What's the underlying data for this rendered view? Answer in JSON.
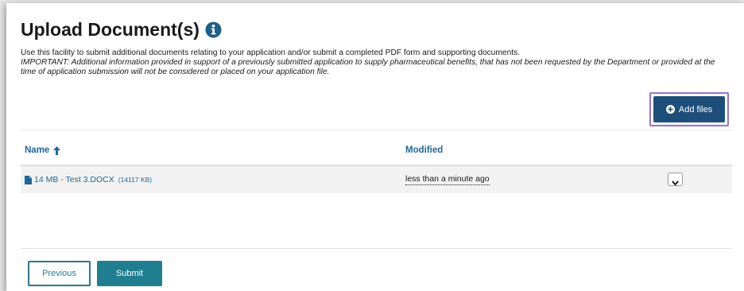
{
  "page": {
    "title": "Upload Document(s)",
    "intro": "Use this facility to submit additional documents relating to your application and/or submit a completed PDF form and supporting documents.",
    "important": "IMPORTANT: Additional information provided in support of a previously submitted application to supply pharmaceutical benefits, that has not been requested by the Department or provided at the time of application submission will not be considered or placed on your application file."
  },
  "toolbar": {
    "add_files_label": "Add files"
  },
  "table": {
    "columns": [
      {
        "label": "Name",
        "sort": "ascending"
      },
      {
        "label": "Modified"
      }
    ],
    "rows": [
      {
        "name": "14 MB - Test 3.DOCX",
        "size": "(14117 KB)",
        "modified": "less than a minute ago"
      }
    ]
  },
  "footer": {
    "previous_label": "Previous",
    "submit_label": "Submit"
  },
  "icons": {
    "info": "info-circle-icon",
    "add": "plus-circle-icon",
    "sort": "arrow-up-icon",
    "file": "file-icon",
    "menu": "chevron-down-icon"
  },
  "colors": {
    "link": "#1e6796",
    "primary": "#1e4f7a",
    "teal": "#1f7e90",
    "highlight": "#9b6fd0"
  }
}
